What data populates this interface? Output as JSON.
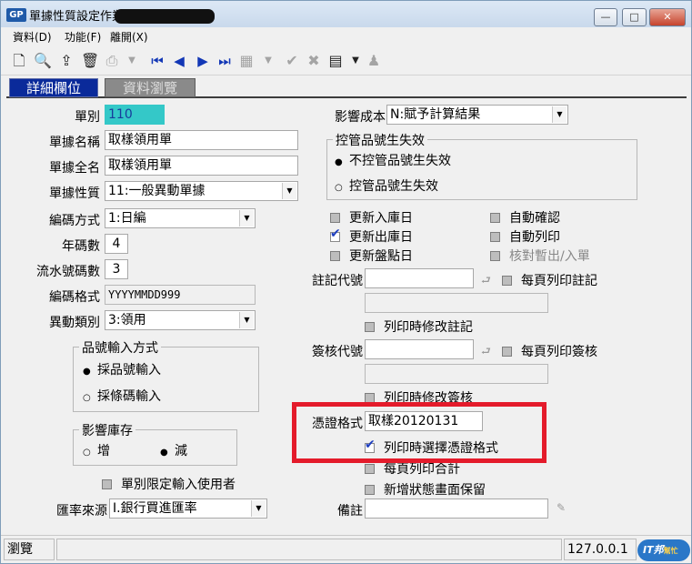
{
  "window": {
    "app_icon": "GP",
    "title": "單據性質設定作業",
    "controls": {
      "minimize": "—",
      "maximize": "□",
      "close": "✕"
    }
  },
  "menu": [
    {
      "label": "資料(D)"
    },
    {
      "label": "功能(F)"
    },
    {
      "label": "離開(X)"
    }
  ],
  "toolbar": {
    "icons": [
      "new-doc-icon",
      "preview-icon",
      "export-icon",
      "trash-icon",
      "print-icon",
      "dropdown-icon",
      "first-record-icon",
      "prev-record-icon",
      "next-record-icon",
      "last-record-icon",
      "grid-icon",
      "confirm-icon",
      "cancel-icon",
      "edit-icon",
      "user-icon"
    ]
  },
  "tabs": [
    {
      "label": "詳細欄位",
      "active": true
    },
    {
      "label": "資料瀏覽",
      "active": false
    }
  ],
  "form": {
    "doc_type_label": "單別",
    "doc_type_value": "110",
    "doc_name_label": "單據名稱",
    "doc_name_value": "取樣領用單",
    "doc_fullname_label": "單據全名",
    "doc_fullname_value": "取樣領用單",
    "doc_nature_label": "單據性質",
    "doc_nature_value": "11:一般異動單據",
    "coding_label": "編碼方式",
    "coding_value": "1:日編",
    "year_digits_label": "年碼數",
    "year_digits_value": "4",
    "serial_digits_label": "流水號碼數",
    "serial_digits_value": "3",
    "code_format_label": "編碼格式",
    "code_format_value": "YYYYMMDD999",
    "change_type_label": "異動類別",
    "change_type_value": "3:領用",
    "item_input": {
      "title": "品號輸入方式",
      "options": [
        "採品號輸入",
        "採條碼輸入"
      ],
      "selected": 0
    },
    "stock_effect": {
      "title": "影響庫存",
      "options": [
        "增",
        "減"
      ],
      "selected": 1
    },
    "limit_input_label": "單別限定輸入使用者",
    "rate_source_label": "匯率來源",
    "rate_source_value": "I.銀行買進匯率",
    "cost_effect_label": "影響成本",
    "cost_effect_value": "N:賦予計算結果",
    "lot_invalid": {
      "title": "控管品號生失效",
      "options": [
        "不控管品號生失效",
        "控管品號生失效"
      ],
      "selected": 0
    },
    "checks_left": [
      {
        "label": "更新入庫日",
        "checked": false
      },
      {
        "label": "更新出庫日",
        "checked": true
      },
      {
        "label": "更新盤點日",
        "checked": false
      }
    ],
    "checks_right": [
      {
        "label": "自動確認",
        "checked": false
      },
      {
        "label": "自動列印",
        "checked": false
      },
      {
        "label": "核對暫出/入單",
        "checked": false
      }
    ],
    "note_code_label": "註記代號",
    "print_note_each_page": "每頁列印註記",
    "print_edit_note": "列印時修改註記",
    "sign_code_label": "簽核代號",
    "print_sign_each_page": "每頁列印簽核",
    "print_edit_sign": "列印時修改簽核",
    "voucher_format_label": "憑證格式",
    "voucher_format_value": "取樣20120131",
    "print_choose_voucher": "列印時選擇憑證格式",
    "print_total_each_page": "每頁列印合計",
    "keep_add_screen": "新增狀態畫面保留",
    "remark_label": "備註"
  },
  "status": {
    "mode": "瀏覽",
    "ip": "127.0.0.1",
    "logo_text": "IT邦",
    "logo_sub": "幫忙"
  }
}
